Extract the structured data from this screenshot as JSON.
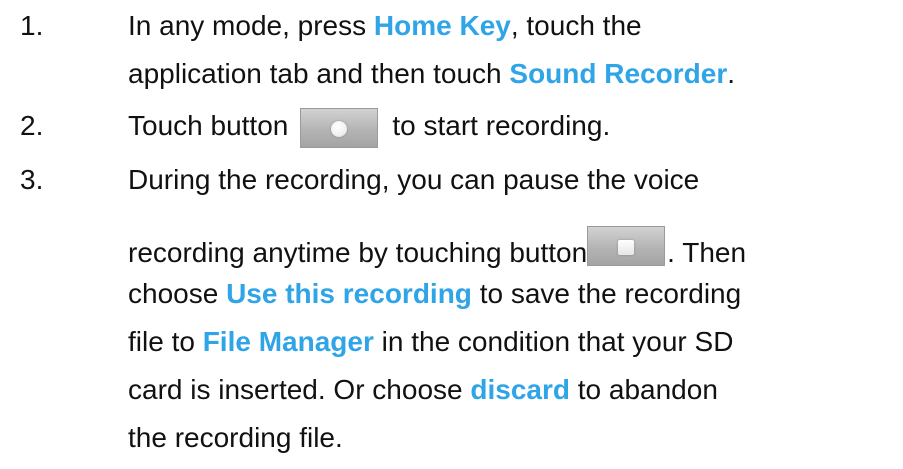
{
  "steps": [
    {
      "number": "1.",
      "line1": {
        "a": "In any mode, press ",
        "hl1": "Home Key",
        "b": ", touch the"
      },
      "line2": {
        "a": "application tab and then touch ",
        "hl1": "Sound Recorder",
        "b": "."
      }
    },
    {
      "number": "2.",
      "line1": {
        "a": "Touch button",
        "b": "to start recording."
      },
      "button_icon": "record-button-icon"
    },
    {
      "number": "3.",
      "line1": {
        "a": "During the recording, you can pause the voice"
      },
      "line2": {
        "a": "recording anytime by touching button",
        "b": ". Then"
      },
      "button_icon": "stop-button-icon",
      "line3": {
        "a": "choose ",
        "hl1": "Use this recording",
        "b": " to save the recording"
      },
      "line4": {
        "a": "file to ",
        "hl1": "File Manager",
        "b": " in the condition that your SD"
      },
      "line5": {
        "a": "card is inserted. Or choose ",
        "hl1": "discard",
        "b": " to abandon"
      },
      "line6": {
        "a": "the recording file."
      }
    }
  ],
  "colors": {
    "highlight": "#2fa4e7",
    "text": "#111111"
  }
}
